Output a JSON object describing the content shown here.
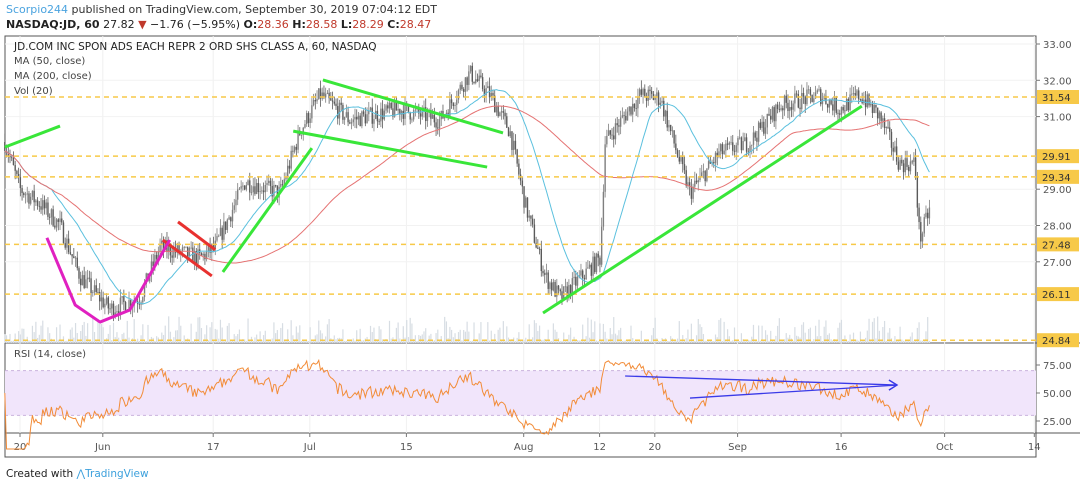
{
  "header": {
    "user": "Scorpio244",
    "published": "published on TradingView.com, September 30, 2019 07:04:12 EDT",
    "symbol": "NASDAQ:JD, 60",
    "last": "27.82",
    "change": "−1.76 (−5.95%)",
    "o_label": "O:",
    "o": "28.36",
    "h_label": "H:",
    "h": "28.58",
    "l_label": "L:",
    "l": "28.29",
    "c_label": "C:",
    "c": "28.47"
  },
  "legend": {
    "title": "JD.COM INC SPON ADS EACH REPR 2 ORD SHS CLASS A, 60, NASDAQ",
    "ma50": "MA (50, close)",
    "ma200": "MA (200, close)",
    "vol": "Vol (20)",
    "rsi": "RSI (14, close)"
  },
  "footer": {
    "created": "Created with",
    "brand": "TradingView"
  },
  "colors": {
    "up": "#7f7f7f",
    "down": "#5a5a5a",
    "ma50": "#5bc0de",
    "ma200": "#e57373",
    "level": "#f7c948",
    "trend": "#39e639",
    "red": "#e8312f",
    "magenta": "#e020c0",
    "rsi": "#f28c38",
    "rsi_band": "#f1e5fb",
    "arrow": "#3a3ae8"
  },
  "chart_data": {
    "type": "candlestick",
    "x_unit": "days since 2019-05-20",
    "price_axis": {
      "ticks": [
        33,
        32,
        31,
        29,
        28,
        27
      ],
      "labels": [
        "33.00",
        "32.00",
        "31.00",
        "29.00",
        "28.00",
        "27.00"
      ]
    },
    "rsi_axis": {
      "ticks": [
        75,
        50,
        25
      ],
      "labels": [
        "75.00",
        "50.00",
        "25.00"
      ],
      "band": [
        30,
        70
      ]
    },
    "date_ticks": [
      {
        "day": 0,
        "label": "20"
      },
      {
        "day": 12,
        "label": "Jun"
      },
      {
        "day": 28,
        "label": "17"
      },
      {
        "day": 42,
        "label": "Jul"
      },
      {
        "day": 56,
        "label": "15"
      },
      {
        "day": 73,
        "label": "Aug"
      },
      {
        "day": 84,
        "label": "12"
      },
      {
        "day": 92,
        "label": "20"
      },
      {
        "day": 104,
        "label": "Sep"
      },
      {
        "day": 119,
        "label": "16"
      },
      {
        "day": 134,
        "label": "Oct"
      },
      {
        "day": 147,
        "label": "14"
      }
    ],
    "levels": [
      {
        "price": 31.54,
        "label": "31.54"
      },
      {
        "price": 29.91,
        "label": "29.91"
      },
      {
        "price": 29.34,
        "label": "29.34"
      },
      {
        "price": 27.48,
        "label": "27.48"
      },
      {
        "price": 26.11,
        "label": "26.11"
      },
      {
        "price": 24.84,
        "label": "24.84"
      }
    ],
    "price_path": [
      [
        -2.2,
        30.3
      ],
      [
        0,
        29.0
      ],
      [
        2.9,
        28.6
      ],
      [
        5.8,
        28.0
      ],
      [
        8.7,
        26.6
      ],
      [
        13,
        25.7
      ],
      [
        17.4,
        26.0
      ],
      [
        20.3,
        27.4
      ],
      [
        26.1,
        27.1
      ],
      [
        28.3,
        27.4
      ],
      [
        32.6,
        29.2
      ],
      [
        37.7,
        28.9
      ],
      [
        40.6,
        30.6
      ],
      [
        43.5,
        31.6
      ],
      [
        47.8,
        30.9
      ],
      [
        55.1,
        31.2
      ],
      [
        60.9,
        30.9
      ],
      [
        65.2,
        32.2
      ],
      [
        68.1,
        31.6
      ],
      [
        71,
        30.6
      ],
      [
        73.2,
        28.6
      ],
      [
        76.1,
        26.6
      ],
      [
        78.3,
        26.0
      ],
      [
        84.1,
        27.1
      ],
      [
        84.8,
        30.3
      ],
      [
        89.9,
        31.6
      ],
      [
        92.8,
        31.5
      ],
      [
        95.7,
        29.7
      ],
      [
        97.1,
        28.9
      ],
      [
        101.4,
        30.0
      ],
      [
        105.8,
        30.3
      ],
      [
        110.1,
        31.3
      ],
      [
        115.9,
        31.6
      ],
      [
        118.8,
        31.2
      ],
      [
        121.7,
        31.6
      ],
      [
        124.6,
        31.0
      ],
      [
        127.5,
        29.7
      ],
      [
        129.7,
        29.7
      ],
      [
        130.4,
        27.6
      ],
      [
        131.9,
        28.5
      ]
    ],
    "trendlines": [
      {
        "color": "trend",
        "pts": [
          [
            -2.2,
            30.16
          ],
          [
            5.8,
            30.74
          ]
        ]
      },
      {
        "color": "trend",
        "pts": [
          [
            43.9,
            32.01
          ],
          [
            70.0,
            30.55
          ]
        ]
      },
      {
        "color": "trend",
        "pts": [
          [
            39.6,
            30.6
          ],
          [
            67.7,
            29.61
          ]
        ]
      },
      {
        "color": "trend",
        "pts": [
          [
            29.4,
            26.72
          ],
          [
            42.3,
            30.13
          ]
        ]
      },
      {
        "color": "trend",
        "pts": [
          [
            75.8,
            25.59
          ],
          [
            122.0,
            31.29
          ]
        ]
      },
      {
        "color": "red",
        "pts": [
          [
            20.7,
            27.6
          ],
          [
            27.8,
            26.61
          ]
        ]
      },
      {
        "color": "red",
        "pts": [
          [
            22.9,
            28.1
          ],
          [
            28.3,
            27.33
          ]
        ]
      },
      {
        "color": "magenta",
        "curve": true,
        "pts": [
          [
            3.9,
            27.66
          ],
          [
            8.0,
            25.81
          ],
          [
            11.6,
            25.34
          ],
          [
            15.9,
            25.67
          ],
          [
            21.7,
            27.6
          ]
        ]
      }
    ],
    "rsi_arrows": [
      [
        [
          87.7,
          65.2
        ],
        [
          127.1,
          57.1
        ]
      ],
      [
        [
          97.1,
          45.5
        ],
        [
          127.1,
          57.1
        ]
      ]
    ]
  }
}
